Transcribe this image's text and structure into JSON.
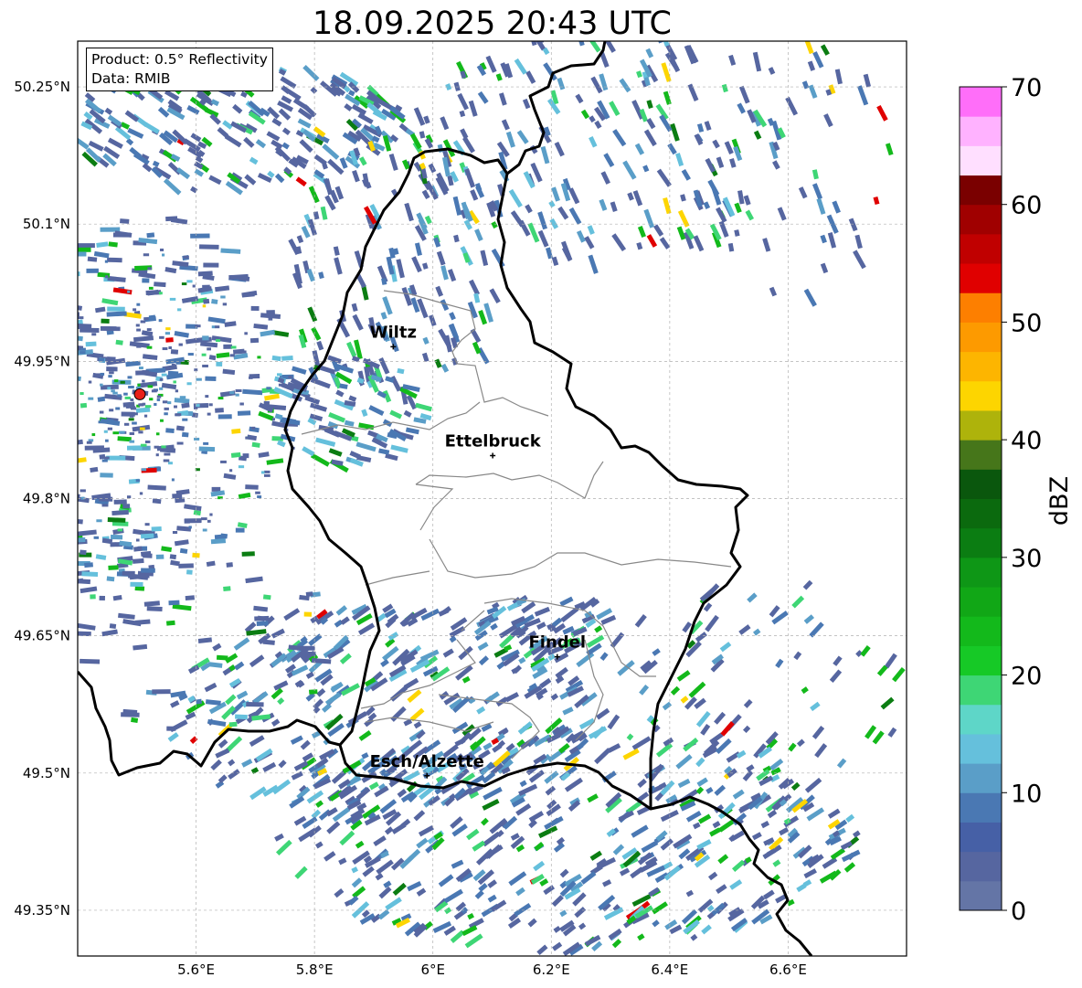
{
  "title": "18.09.2025 20:43 UTC",
  "info": {
    "product": "Product: 0.5° Reflectivity",
    "data": "Data: RMIB"
  },
  "axes": {
    "lon_range": [
      5.4,
      6.8
    ],
    "lat_range": [
      49.3,
      50.3
    ],
    "lon_ticks": [
      {
        "value": 5.6,
        "label": "5.6°E"
      },
      {
        "value": 5.8,
        "label": "5.8°E"
      },
      {
        "value": 6.0,
        "label": "6°E"
      },
      {
        "value": 6.2,
        "label": "6.2°E"
      },
      {
        "value": 6.4,
        "label": "6.4°E"
      },
      {
        "value": 6.6,
        "label": "6.6°E"
      }
    ],
    "lat_ticks": [
      {
        "value": 50.25,
        "label": "50.25°N"
      },
      {
        "value": 50.1,
        "label": "50.1°N"
      },
      {
        "value": 49.95,
        "label": "49.95°N"
      },
      {
        "value": 49.8,
        "label": "49.8°N"
      },
      {
        "value": 49.65,
        "label": "49.65°N"
      },
      {
        "value": 49.5,
        "label": "49.5°N"
      },
      {
        "value": 49.35,
        "label": "49.35°N"
      }
    ],
    "grid": true
  },
  "cities": [
    {
      "name": "Wiltz",
      "lon": 5.933,
      "lat": 49.966
    },
    {
      "name": "Ettelbruck",
      "lon": 6.101,
      "lat": 49.847
    },
    {
      "name": "Findel",
      "lon": 6.21,
      "lat": 49.627
    },
    {
      "name": "Esch/Alzette",
      "lon": 5.99,
      "lat": 49.497
    }
  ],
  "radar_site": {
    "lon": 5.505,
    "lat": 49.914
  },
  "colorbar": {
    "label": "dBZ",
    "min": 0,
    "max": 70,
    "step": 2.5,
    "ticks": [
      {
        "value": 0,
        "label": "0"
      },
      {
        "value": 10,
        "label": "10"
      },
      {
        "value": 20,
        "label": "20"
      },
      {
        "value": 30,
        "label": "30"
      },
      {
        "value": 40,
        "label": "40"
      },
      {
        "value": 50,
        "label": "50"
      },
      {
        "value": 60,
        "label": "60"
      },
      {
        "value": 70,
        "label": "70"
      }
    ],
    "colors": [
      "#6475a6",
      "#5666a0",
      "#4660a6",
      "#4a78b3",
      "#5a9ec8",
      "#65c0dc",
      "#5ed6c8",
      "#3ed675",
      "#16c926",
      "#13b91b",
      "#11a716",
      "#0e9716",
      "#0b7d12",
      "#0b6a0e",
      "#0a570d",
      "#46761a",
      "#aeb30b",
      "#fdd500",
      "#fdb500",
      "#fd9a00",
      "#fd7f00",
      "#e00000",
      "#c00000",
      "#a00000",
      "#7a0000",
      "#ffdfff",
      "#ffb2ff",
      "#ff6ef9",
      "#e83ae8"
    ]
  },
  "chart_data": {
    "type": "radar-map",
    "title": "18.09.2025 20:43 UTC",
    "lon_range": [
      5.4,
      6.8
    ],
    "lat_range": [
      49.3,
      50.3
    ],
    "colorbar_label": "dBZ",
    "colorbar_range": [
      0,
      70
    ],
    "echo_regions": [
      {
        "lon": 5.72,
        "lat": 50.2,
        "dbz": 12
      },
      {
        "lon": 5.55,
        "lat": 49.95,
        "dbz": 15
      },
      {
        "lon": 5.95,
        "lat": 50.1,
        "dbz": 14
      },
      {
        "lon": 6.3,
        "lat": 50.15,
        "dbz": 14
      },
      {
        "lon": 5.85,
        "lat": 49.45,
        "dbz": 10
      },
      {
        "lon": 6.2,
        "lat": 49.4,
        "dbz": 8
      }
    ]
  }
}
